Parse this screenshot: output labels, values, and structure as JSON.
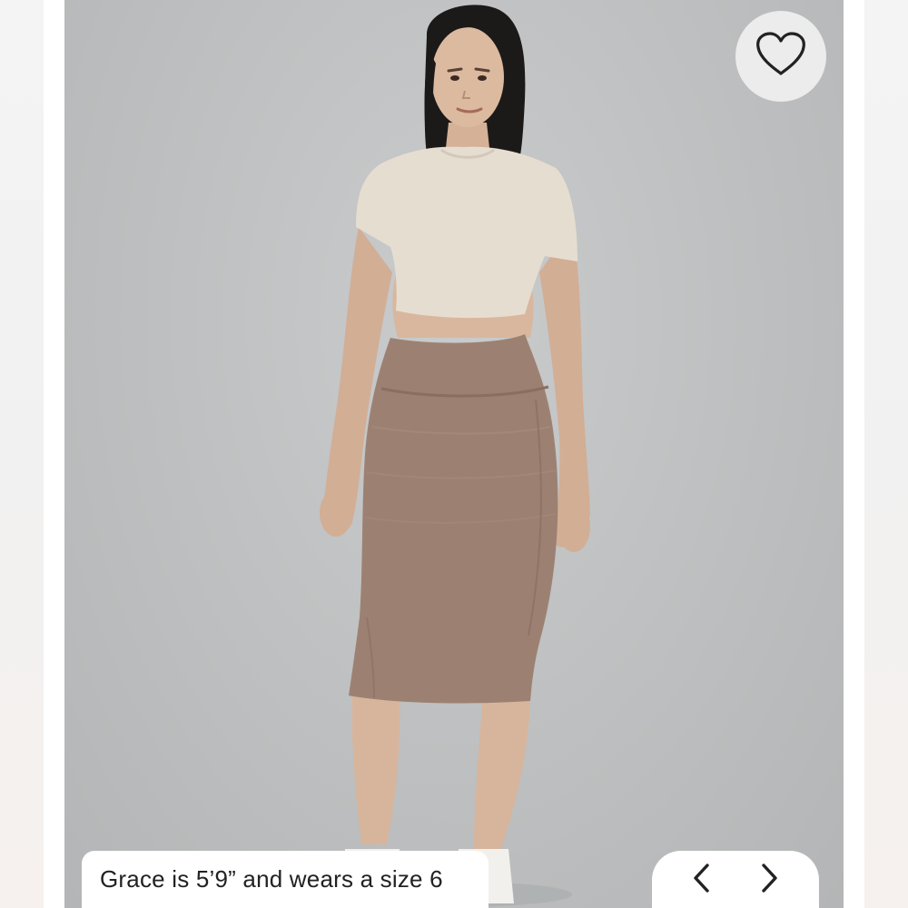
{
  "caption": {
    "text": "Grace is 5’9” and wears a size 6"
  },
  "icons": {
    "favorite": "heart-icon",
    "previous": "chevron-left-icon",
    "next": "chevron-right-icon"
  },
  "colors": {
    "background": "#bfc1c2",
    "top": "#e6ddd1",
    "skirt": "#9c8172",
    "skin": "#d7b59c",
    "hair": "#1c1a19"
  }
}
